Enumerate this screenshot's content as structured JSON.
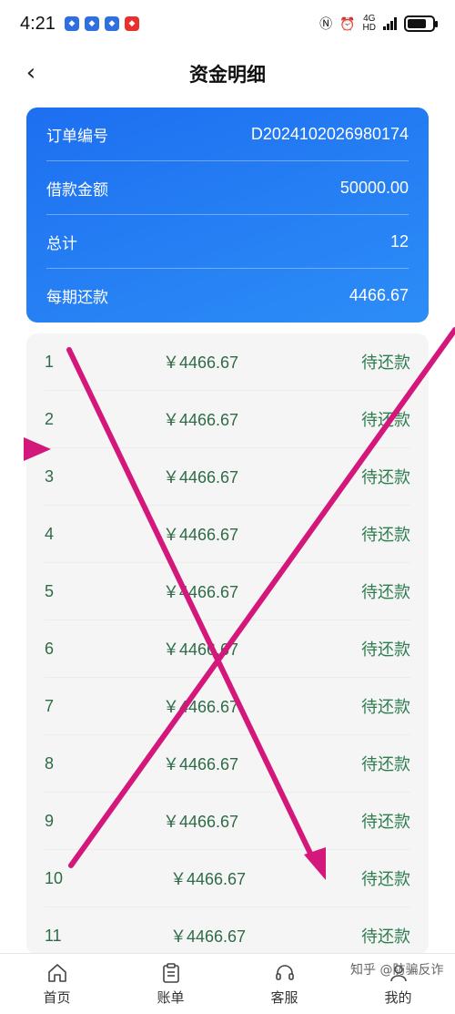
{
  "status_bar": {
    "time": "4:21",
    "network": "4G",
    "network_sub": "HD"
  },
  "header": {
    "back_symbol": "‹",
    "title": "资金明细"
  },
  "summary": {
    "rows": [
      {
        "label": "订单编号",
        "value": "D2024102026980174"
      },
      {
        "label": "借款金额",
        "value": "50000.00"
      },
      {
        "label": "总计",
        "value": "12"
      },
      {
        "label": "每期还款",
        "value": "4466.67"
      }
    ]
  },
  "installments": {
    "rows": [
      {
        "num": "1",
        "amount": "￥4466.67",
        "status": "待还款"
      },
      {
        "num": "2",
        "amount": "￥4466.67",
        "status": "待还款"
      },
      {
        "num": "3",
        "amount": "￥4466.67",
        "status": "待还款"
      },
      {
        "num": "4",
        "amount": "￥4466.67",
        "status": "待还款"
      },
      {
        "num": "5",
        "amount": "￥4466.67",
        "status": "待还款"
      },
      {
        "num": "6",
        "amount": "￥4466.67",
        "status": "待还款"
      },
      {
        "num": "7",
        "amount": "￥4466.67",
        "status": "待还款"
      },
      {
        "num": "8",
        "amount": "￥4466.67",
        "status": "待还款"
      },
      {
        "num": "9",
        "amount": "￥4466.67",
        "status": "待还款"
      },
      {
        "num": "10",
        "amount": "￥4466.67",
        "status": "待还款"
      },
      {
        "num": "11",
        "amount": "￥4466.67",
        "status": "待还款"
      }
    ]
  },
  "bottom_nav": {
    "items": [
      {
        "label": "首页",
        "icon": "home-icon"
      },
      {
        "label": "账单",
        "icon": "bill-icon"
      },
      {
        "label": "客服",
        "icon": "headset-icon"
      },
      {
        "label": "我的",
        "icon": "profile-icon"
      }
    ]
  },
  "watermark": "知乎 @防骗反诈",
  "colors": {
    "card_blue": "#1d6ff0",
    "status_green": "#2e7d4f",
    "overlay_magenta": "#d4177a"
  }
}
